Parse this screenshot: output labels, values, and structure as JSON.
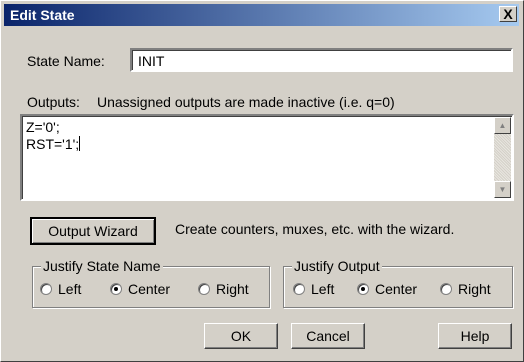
{
  "window": {
    "title": "Edit State",
    "close_glyph": "X"
  },
  "state_name": {
    "label": "State Name:",
    "value": "INIT"
  },
  "outputs": {
    "label": "Outputs:",
    "hint": "Unassigned outputs are made inactive (i.e. q=0)",
    "text": "Z='0';\nRST='1';"
  },
  "wizard": {
    "button_label": "Output Wizard",
    "description": "Create counters, muxes, etc. with the wizard."
  },
  "justify_state_name": {
    "legend": "Justify State Name",
    "options": [
      "Left",
      "Center",
      "Right"
    ],
    "selected": "Center"
  },
  "justify_output": {
    "legend": "Justify Output",
    "options": [
      "Left",
      "Center",
      "Right"
    ],
    "selected": "Center"
  },
  "buttons": {
    "ok": "OK",
    "cancel": "Cancel",
    "help": "Help"
  }
}
